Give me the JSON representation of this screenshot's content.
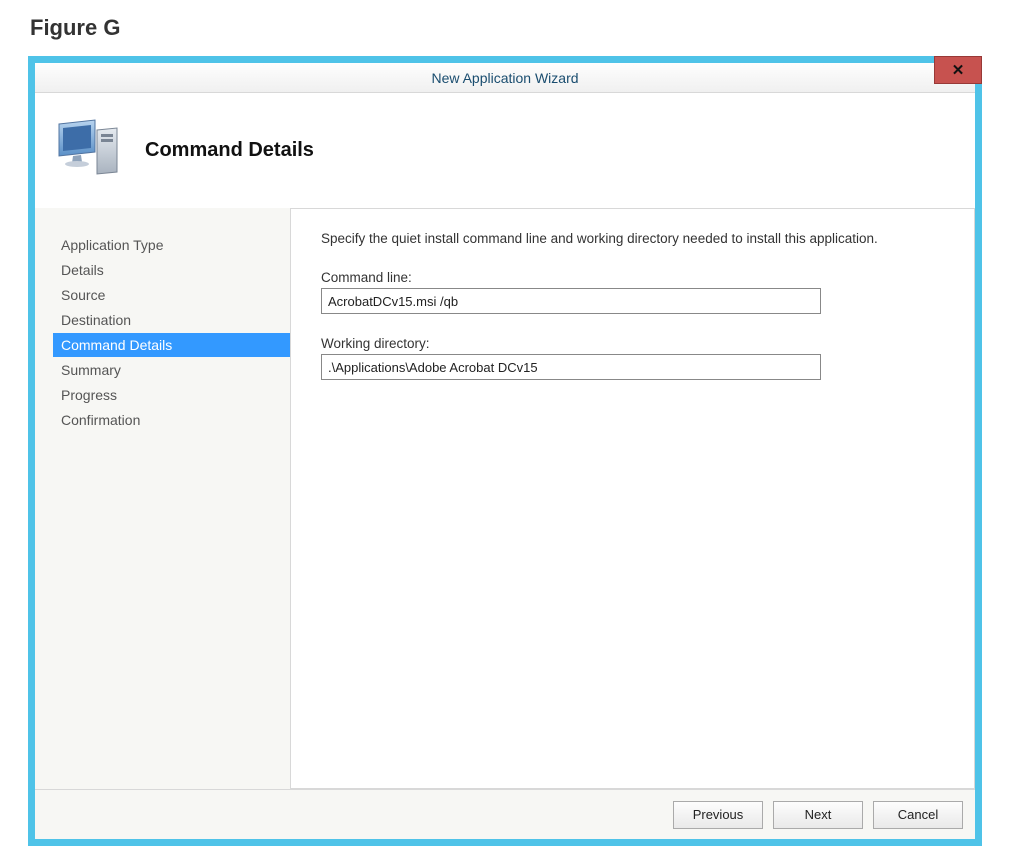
{
  "figure_label": "Figure G",
  "window": {
    "title": "New Application Wizard",
    "close_glyph": "✕"
  },
  "header": {
    "title": "Command Details"
  },
  "sidebar": {
    "items": [
      {
        "label": "Application Type",
        "selected": false
      },
      {
        "label": "Details",
        "selected": false
      },
      {
        "label": "Source",
        "selected": false
      },
      {
        "label": "Destination",
        "selected": false
      },
      {
        "label": "Command Details",
        "selected": true
      },
      {
        "label": "Summary",
        "selected": false
      },
      {
        "label": "Progress",
        "selected": false
      },
      {
        "label": "Confirmation",
        "selected": false
      }
    ]
  },
  "main": {
    "instruction": "Specify the quiet install command line and working directory needed to install this application.",
    "command_line_label": "Command line:",
    "command_line_value": "AcrobatDCv15.msi /qb",
    "working_dir_label": "Working directory:",
    "working_dir_value": ".\\Applications\\Adobe Acrobat DCv15"
  },
  "footer": {
    "previous_label": "Previous",
    "next_label": "Next",
    "cancel_label": "Cancel"
  }
}
